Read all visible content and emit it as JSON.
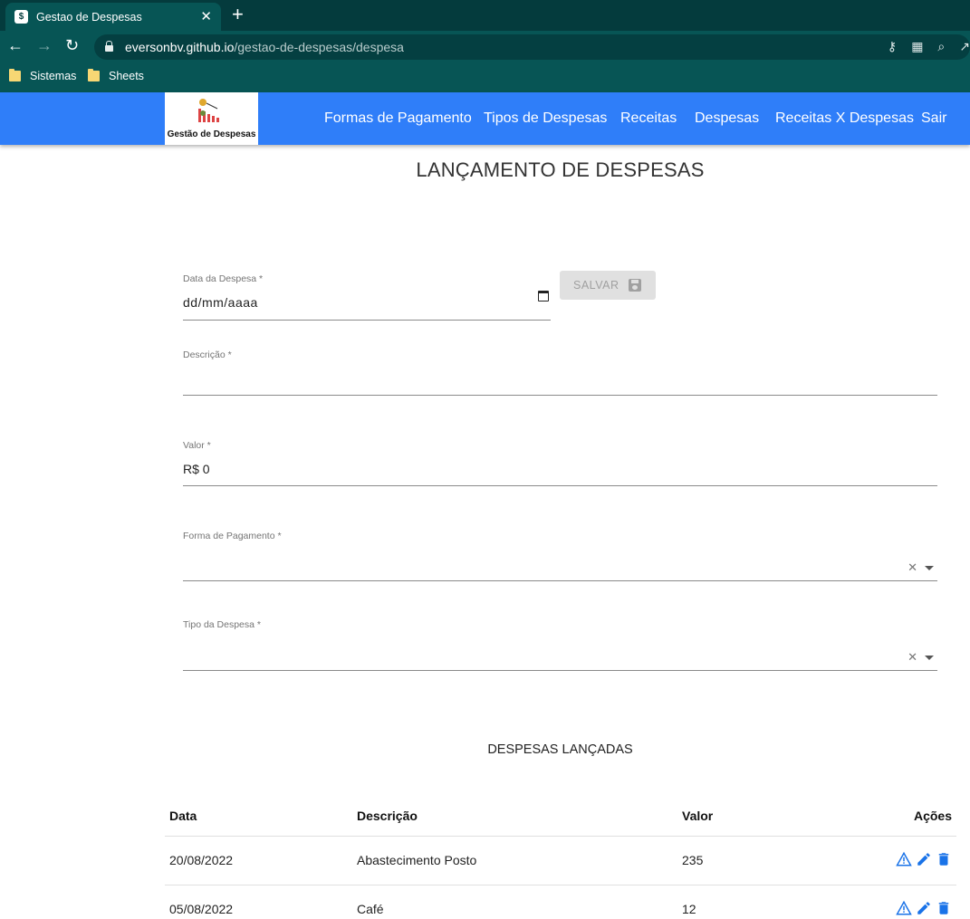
{
  "browser": {
    "tab_title": "Gestao de Despesas",
    "url_host": "eversonbv.github.io",
    "url_path": "/gestao-de-despesas/despesa",
    "bookmarks": [
      "Sistemas",
      "Sheets"
    ]
  },
  "navbar": {
    "logo_text": "Gestão de Despesas",
    "items": [
      "Formas de Pagamento",
      "Tipos de Despesas",
      "Receitas",
      "Despesas",
      "Receitas X Despesas",
      "Sair"
    ]
  },
  "page": {
    "title": "LANÇAMENTO DE DESPESAS"
  },
  "form": {
    "data_label": "Data da Despesa *",
    "data_value": "dd/mm/aaaa",
    "save_label": "SALVAR",
    "descricao_label": "Descrição *",
    "descricao_value": "",
    "valor_label": "Valor *",
    "valor_value": "R$ 0",
    "forma_label": "Forma de Pagamento *",
    "forma_value": "",
    "tipo_label": "Tipo da Despesa *",
    "tipo_value": ""
  },
  "list": {
    "title": "DESPESAS LANÇADAS",
    "headers": [
      "Data",
      "Descrição",
      "Valor",
      "Ações"
    ],
    "rows": [
      {
        "data": "20/08/2022",
        "descricao": "Abastecimento Posto",
        "valor": "235"
      },
      {
        "data": "05/08/2022",
        "descricao": "Café",
        "valor": "12"
      }
    ]
  },
  "colors": {
    "browser_frame": "#075555",
    "navbar": "#2f7ef9",
    "action_icons": "#1a73e8"
  }
}
